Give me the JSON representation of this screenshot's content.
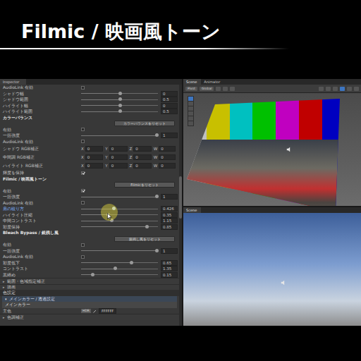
{
  "header": {
    "title": "Filmic / 映画風トーン"
  },
  "inspector": {
    "tab": "Inspector",
    "rows": [
      {
        "kind": "checkbox",
        "label": "AudioLink 有効",
        "checked": false
      },
      {
        "kind": "slider",
        "label": "シャドウ幅",
        "level": 0.5,
        "reading": "0",
        "active": false
      },
      {
        "kind": "slider",
        "label": "シャドウ範囲",
        "level": 0.5,
        "reading": "0.5",
        "active": false
      },
      {
        "kind": "slider",
        "label": "ハイライト幅",
        "level": 0.5,
        "reading": "0",
        "active": false
      },
      {
        "kind": "slider",
        "label": "ハイライト範囲",
        "level": 0.5,
        "reading": "0.5",
        "active": false
      },
      {
        "kind": "header",
        "label": "カラーバランス"
      },
      {
        "kind": "button",
        "label": "カラーバランスをリセット"
      },
      {
        "kind": "checkbox",
        "label": "有効",
        "checked": false
      },
      {
        "kind": "slider",
        "label": "一括強度",
        "level": 0.98,
        "reading": "1",
        "active": false
      },
      {
        "kind": "checkbox",
        "label": "AudioLink 有効",
        "checked": false
      },
      {
        "kind": "vector",
        "label": "シャドウ RGB補正",
        "fields": [
          {
            "axis": "X",
            "value": "0"
          },
          {
            "axis": "Y",
            "value": "0"
          },
          {
            "axis": "Z",
            "value": "0"
          },
          {
            "axis": "W",
            "value": "0"
          }
        ]
      },
      {
        "kind": "vector",
        "label": "中間調 RGB補正",
        "fields": [
          {
            "axis": "X",
            "value": "0"
          },
          {
            "axis": "Y",
            "value": "0"
          },
          {
            "axis": "Z",
            "value": "0"
          },
          {
            "axis": "W",
            "value": "0"
          }
        ]
      },
      {
        "kind": "vector",
        "label": "ハイライト RGB補正",
        "fields": [
          {
            "axis": "X",
            "value": "0"
          },
          {
            "axis": "Y",
            "value": "0"
          },
          {
            "axis": "Z",
            "value": "0"
          },
          {
            "axis": "W",
            "value": "0"
          }
        ]
      },
      {
        "kind": "checkbox",
        "label": "輝度を保持",
        "checked": true
      },
      {
        "kind": "header",
        "label": "Filmic / 映画風トーン"
      },
      {
        "kind": "button",
        "label": "Filmicをリセット"
      },
      {
        "kind": "checkbox",
        "label": "有効",
        "checked": true
      },
      {
        "kind": "slider",
        "label": "一括強度",
        "level": 0.98,
        "reading": "1",
        "active": false
      },
      {
        "kind": "checkbox",
        "label": "AudioLink 有効",
        "checked": false
      },
      {
        "kind": "slider",
        "label": "肩の絞り方",
        "level": 0.42,
        "reading": "0.426",
        "active": true
      },
      {
        "kind": "slider",
        "label": "ハイライト圧縮",
        "level": 0.35,
        "reading": "0.35",
        "active": false
      },
      {
        "kind": "slider",
        "label": "中間コントラスト",
        "level": 0.39,
        "reading": "1.15",
        "active": false
      },
      {
        "kind": "slider",
        "label": "彩度保持",
        "level": 0.85,
        "reading": "0.85",
        "active": false
      },
      {
        "kind": "header",
        "label": "Bleach Bypass / 銀残し風"
      },
      {
        "kind": "button",
        "label": "銀残し風をリセット"
      },
      {
        "kind": "checkbox",
        "label": "有効",
        "checked": false
      },
      {
        "kind": "slider",
        "label": "一括強度",
        "level": 0.98,
        "reading": "1",
        "active": false
      },
      {
        "kind": "checkbox",
        "label": "AudioLink 有効",
        "checked": false
      },
      {
        "kind": "slider",
        "label": "彩度低下",
        "level": 0.65,
        "reading": "0.65",
        "active": false
      },
      {
        "kind": "slider",
        "label": "コントラスト",
        "level": 0.44,
        "reading": "1.35",
        "active": false
      },
      {
        "kind": "slider",
        "label": "黒締め",
        "level": 0.15,
        "reading": "0.15",
        "active": false
      },
      {
        "kind": "foldout",
        "icon": "▸",
        "label": "範囲・色域指定補正",
        "expanded": false
      },
      {
        "kind": "foldout",
        "icon": "▸",
        "label": "描画",
        "expanded": false
      },
      {
        "kind": "section",
        "label": "色設定"
      },
      {
        "kind": "group",
        "icon": "▾",
        "label": "メインカラー / 透過設定",
        "expanded": true
      },
      {
        "kind": "subheader",
        "label": "メインカラー"
      },
      {
        "kind": "color",
        "label": "主色",
        "badge": "HDR",
        "value": "FFFFFF"
      },
      {
        "kind": "foldout",
        "icon": "▸",
        "label": "色調補正",
        "expanded": false
      }
    ]
  },
  "scene_top": {
    "tabs": [
      {
        "label": "Scene",
        "selected": true
      },
      {
        "label": "Animator",
        "selected": false
      }
    ],
    "toolbar": [
      "Pivot",
      "Global"
    ]
  },
  "scene_bottom": {
    "tabs": [
      {
        "label": "Scene",
        "selected": true
      }
    ]
  }
}
